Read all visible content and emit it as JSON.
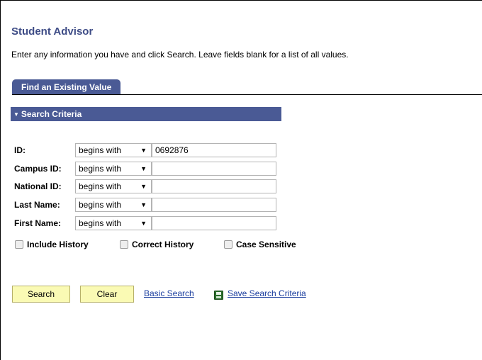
{
  "header": {
    "title": "Student Advisor",
    "instructions": "Enter any information you have and click Search. Leave fields blank for a list of all values."
  },
  "tab": {
    "label": "Find an Existing Value"
  },
  "section": {
    "label": "Search Criteria"
  },
  "fields": [
    {
      "label": "ID:",
      "operator": "begins with",
      "value": "0692876"
    },
    {
      "label": "Campus ID:",
      "operator": "begins with",
      "value": ""
    },
    {
      "label": "National ID:",
      "operator": "begins with",
      "value": ""
    },
    {
      "label": "Last Name:",
      "operator": "begins with",
      "value": ""
    },
    {
      "label": "First Name:",
      "operator": "begins with",
      "value": ""
    }
  ],
  "checkboxes": [
    {
      "label": "Include History",
      "checked": false
    },
    {
      "label": "Correct History",
      "checked": false
    },
    {
      "label": "Case Sensitive",
      "checked": false
    }
  ],
  "actions": {
    "search_label": "Search",
    "clear_label": "Clear",
    "basic_search_label": "Basic Search",
    "save_criteria_label": "Save Search Criteria"
  },
  "icons": {
    "section_toggle": "triangle-down-icon",
    "save": "save-disk-icon",
    "dropdown": "caret-down-icon"
  },
  "colors": {
    "accent": "#4a5a95",
    "title": "#3e4c86",
    "button": "#fafab4",
    "link": "#1a3d9e"
  }
}
